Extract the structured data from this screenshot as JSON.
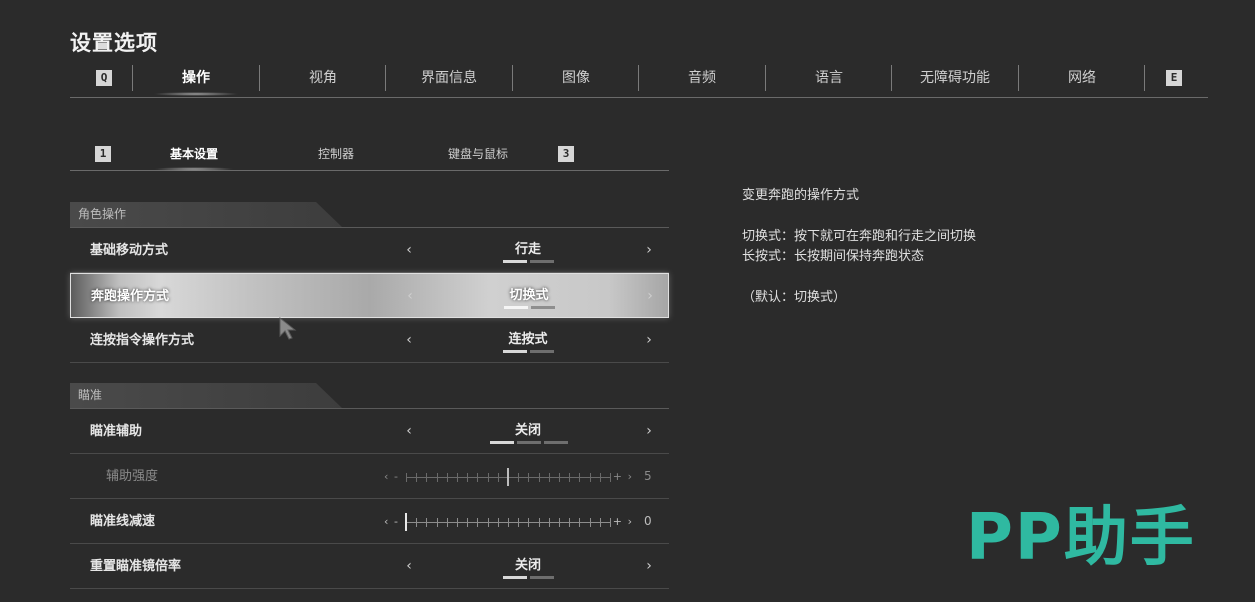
{
  "page_title": "设置选项",
  "top_tabs": {
    "left_key": "Q",
    "right_key": "E",
    "items": [
      "操作",
      "视角",
      "界面信息",
      "图像",
      "音频",
      "语言",
      "无障碍功能",
      "网络"
    ],
    "active_index": 0
  },
  "sub_tabs": {
    "left_key": "1",
    "right_key": "3",
    "items": [
      "基本设置",
      "控制器",
      "键盘与鼠标"
    ],
    "active_index": 0
  },
  "sections": [
    {
      "title": "角色操作",
      "rows": [
        {
          "label": "基础移动方式",
          "type": "select",
          "value": "行走",
          "options_count": 2,
          "selected_index": 0
        },
        {
          "label": "奔跑操作方式",
          "type": "select",
          "value": "切换式",
          "options_count": 2,
          "selected_index": 0,
          "selected": true
        },
        {
          "label": "连按指令操作方式",
          "type": "select",
          "value": "连按式",
          "options_count": 2,
          "selected_index": 0
        }
      ]
    },
    {
      "title": "瞄准",
      "rows": [
        {
          "label": "瞄准辅助",
          "type": "select",
          "value": "关闭",
          "options_count": 3,
          "selected_index": 0
        },
        {
          "label": "辅助强度",
          "type": "slider",
          "value": "5",
          "min": 0,
          "max": 10,
          "disabled": true
        },
        {
          "label": "瞄准线减速",
          "type": "slider",
          "value": "0",
          "min": 0,
          "max": 10
        },
        {
          "label": "重置瞄准镜倍率",
          "type": "select",
          "value": "关闭",
          "options_count": 2,
          "selected_index": 0
        }
      ]
    }
  ],
  "description": {
    "title": "变更奔跑的操作方式",
    "lines": [
      "切换式：按下就可在奔跑和行走之间切换",
      "长按式：长按期间保持奔跑状态"
    ],
    "default_note": "（默认：切换式）"
  },
  "glyphs": {
    "left": "‹",
    "right": "›",
    "minus": "-",
    "plus": "+"
  },
  "watermark": "PP助手"
}
